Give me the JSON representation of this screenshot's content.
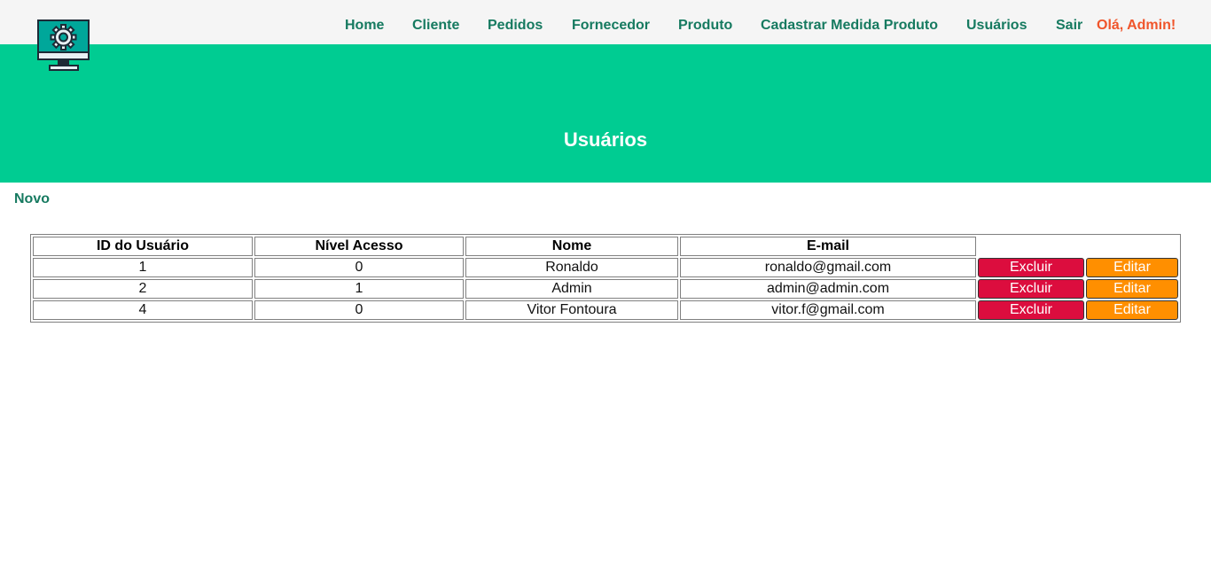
{
  "nav": {
    "items": [
      "Home",
      "Cliente",
      "Pedidos",
      "Fornecedor",
      "Produto",
      "Cadastrar Medida Produto",
      "Usuários",
      "Sair"
    ],
    "greeting": "Olá, Admin!"
  },
  "logo_icon": "monitor-gear-icon",
  "page_title": "Usuários",
  "new_link": "Novo",
  "table": {
    "headers": [
      "ID do Usuário",
      "Nível Acesso",
      "Nome",
      "E-mail"
    ],
    "rows": [
      {
        "id": "1",
        "nivel": "0",
        "nome": "Ronaldo",
        "email": "ronaldo@gmail.com"
      },
      {
        "id": "2",
        "nivel": "1",
        "nome": "Admin",
        "email": "admin@admin.com"
      },
      {
        "id": "4",
        "nivel": "0",
        "nome": "Vitor Fontoura",
        "email": "vitor.f@gmail.com"
      }
    ],
    "delete_label": "Excluir",
    "edit_label": "Editar"
  },
  "colors": {
    "brand_green": "#00cc92",
    "nav_text": "#167a60",
    "greeting": "#f0552b",
    "delete_button": "#dc0d3e",
    "edit_button": "#ff8f00"
  }
}
